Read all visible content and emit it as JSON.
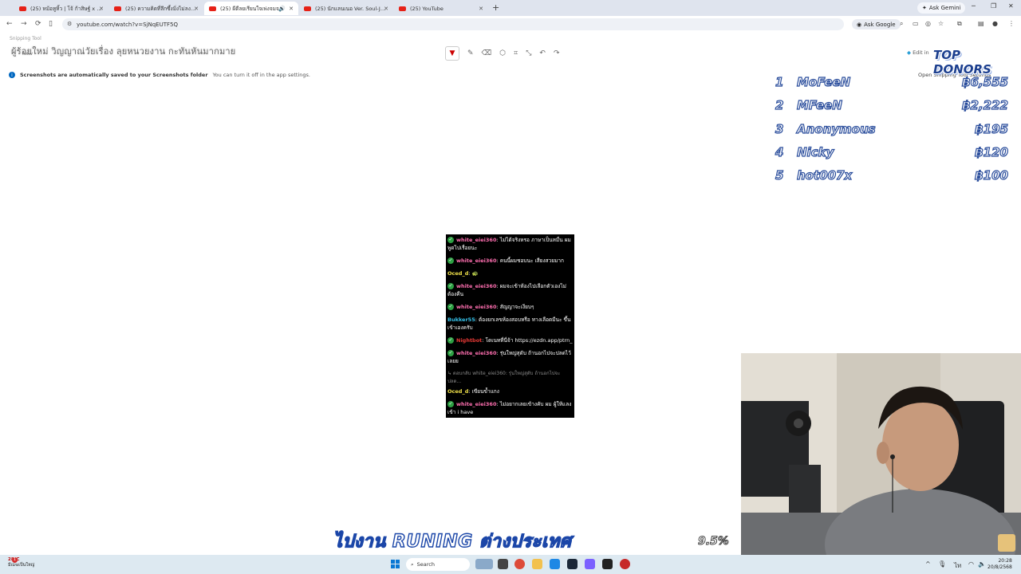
{
  "browser": {
    "tabs": [
      {
        "label": "(25) หม้อหูหิ้ว | โจ้ ก้าสิษฐ์ x To…",
        "active": false
      },
      {
        "label": "(25) ความคิดที่ลึกซึ้งมิ่งไม่ลงลังไม่ไม่…",
        "active": false
      },
      {
        "label": "(25) ผีดีลยเรียนใจเพ่งจมจนไม่ เป…",
        "active": true
      },
      {
        "label": "(25) นักแลนเนอ Ver. Soul-Jazz | บ…",
        "active": false
      },
      {
        "label": "(25) YouTube",
        "active": false
      }
    ],
    "new_tab": "+",
    "ask_gemini": "Ask Gemini",
    "url": "youtube.com/watch?v=SjNqEUTF5Q",
    "ask_google": "Ask Google"
  },
  "snipping": {
    "app_title": "Snipping Tool",
    "video_title": "ผู้ร้อยใหม่ วิญญาณ่วัยเรื่อง ลุยหนวยงาน กะทันหันมากมาย",
    "new_label": "New",
    "edit_in": "Edit in",
    "info_bold": "Screenshots are automatically saved to your Screenshots folder",
    "info_text": "You can turn it off in the app settings.",
    "open_settings": "Open Snipping Tool Settings"
  },
  "donors": {
    "title": "TOP DONORS",
    "list": [
      {
        "rank": "1",
        "name": "MoFeeN",
        "amount": "฿6,555"
      },
      {
        "rank": "2",
        "name": "MFeeN",
        "amount": "฿2,222"
      },
      {
        "rank": "3",
        "name": "Anonymous",
        "amount": "฿195"
      },
      {
        "rank": "4",
        "name": "Nicky",
        "amount": "฿120"
      },
      {
        "rank": "5",
        "name": "hot007x",
        "amount": "฿100"
      }
    ]
  },
  "chat": {
    "messages": [
      {
        "user": "white_eiei360",
        "text": ": ไม่ได้จริงหรอ ภาษาเป็นหมื่น ผมพูดไปเรื่อยนะ",
        "color": "pink",
        "verified": true
      },
      {
        "user": "white_eiei360",
        "text": ": คนนี้ผมชอบนะ เสียงสวยมาก",
        "color": "pink",
        "verified": true
      },
      {
        "user": "Oced_d",
        "text": ": 🐢",
        "color": "yellow",
        "verified": false
      },
      {
        "user": "white_eiei360",
        "text": ": ผมจะเข้าห้องไปเลือกตัวเองไม่ต้องคืน",
        "color": "pink",
        "verified": true
      },
      {
        "user": "white_eiei360",
        "text": ": สัญญาจะเงียบๆ",
        "color": "pink",
        "verified": true
      },
      {
        "user": "Bukker55",
        "text": ": ต้องยกเลขห้องสอบหรือ ทางเลือดมีนะ ขึ้นเข้าเองครับ",
        "color": "cyan",
        "verified": false
      },
      {
        "user": "Nightbot",
        "text": ": โดเนทที่นี่จ้า https://ezdn.app/ptrn_",
        "color": "red",
        "verified": true
      },
      {
        "user": "white_eiei360",
        "text": ": รุ่นใหญ่สุดับ ถ้านอกไปจะปลดไว้เลยย",
        "color": "pink",
        "verified": true
      },
      {
        "reply": "↳ ตอบกลับ white_eiei360: รุ่นใหญ่สุดับ ถ้านอกไปจะปลด..."
      },
      {
        "user": "Oced_d",
        "text": ": เขียนข้ำแกง",
        "color": "yellow",
        "verified": false
      },
      {
        "user": "white_eiei360",
        "text": ": ไม่อยากเลยเข้างคับ ผม ผู้ให้แลง เข้า i have",
        "color": "pink",
        "verified": true
      }
    ]
  },
  "stream": {
    "banner": "ไปงาน RUNING ต่างประเทศ",
    "percent": "9.5%"
  },
  "taskbar": {
    "weather_temp": "28°C",
    "weather_desc": "มีเมฆเป็นใหญ่",
    "search_placeholder": "Search",
    "time": "20:28",
    "date": "20/8/2568",
    "notification_count": "1"
  }
}
